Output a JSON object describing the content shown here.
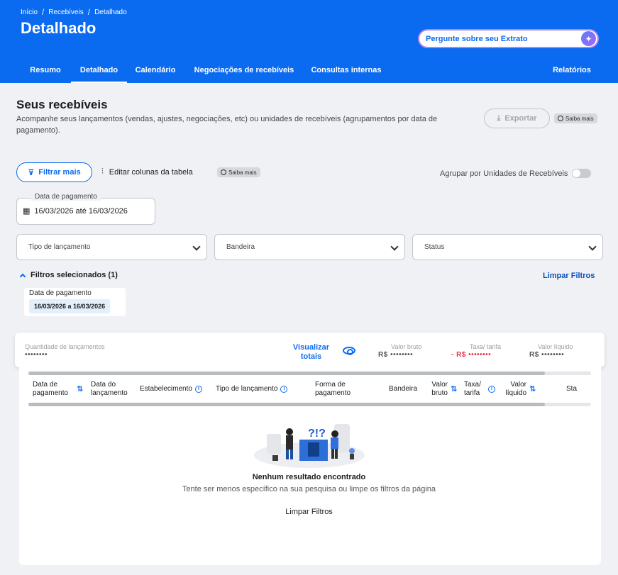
{
  "header": {
    "breadcrumb": [
      "Início",
      "Recebíveis",
      "Detalhado"
    ],
    "title": "Detalhado",
    "ask_label": "Pergunte sobre seu Extrato",
    "tabs": [
      "Resumo",
      "Detalhado",
      "Calendário",
      "Negociações de recebíveis",
      "Consultas internas"
    ],
    "reports": "Relatórios",
    "active_tab": "Detalhado"
  },
  "section": {
    "title": "Seus recebíveis",
    "subtitle": "Acompanhe seus lançamentos (vendas, ajustes, negociações, etc) ou unidades de recebíveis (agrupamentos por data de pagamento).",
    "export_label": "Exportar",
    "saiba_mais": "Saiba mais"
  },
  "filters": {
    "filter_more": "Filtrar mais",
    "edit_columns": "Editar colunas da tabela",
    "saiba_mais": "Saiba mais",
    "group_label": "Agrupar por Unidades de Recebíveis",
    "date_label": "Data de pagamento",
    "date_value": "16/03/2026 até 16/03/2026",
    "selects": [
      "Tipo de lançamento",
      "Bandeira",
      "Status"
    ],
    "selected_title": "Filtros selecionados (1)",
    "clear": "Limpar Filtros",
    "chip_label": "Data de pagamento",
    "chip_value": "16/03/2026 a 16/03/2026"
  },
  "summary": {
    "qty_label": "Quantidade de lançamentos",
    "qty_value": "••••••••",
    "visualize": "Visualizar totais",
    "bruto_label": "Valor bruto",
    "bruto_value": "R$ ••••••••",
    "tarifa_label": "Taxa/ tarifa",
    "tarifa_value": "- R$ ••••••••",
    "liquido_label": "Valor líquido",
    "liquido_value": "R$ ••••••••"
  },
  "table": {
    "columns": [
      "Data de pagamento",
      "Data do lançamento",
      "Estabelecimento",
      "Tipo de lançamento",
      "Forma de pagamento",
      "Bandeira",
      "Valor bruto",
      "Taxa/ tarifa",
      "Valor líquido",
      "Sta"
    ],
    "empty_title": "Nenhum resultado encontrado",
    "empty_sub": "Tente ser menos específico na sua pesquisa ou limpe os filtros da página",
    "empty_clear": "Limpar Filtros"
  },
  "colors": {
    "primary": "#0b6bf0",
    "danger": "#e5344a"
  }
}
